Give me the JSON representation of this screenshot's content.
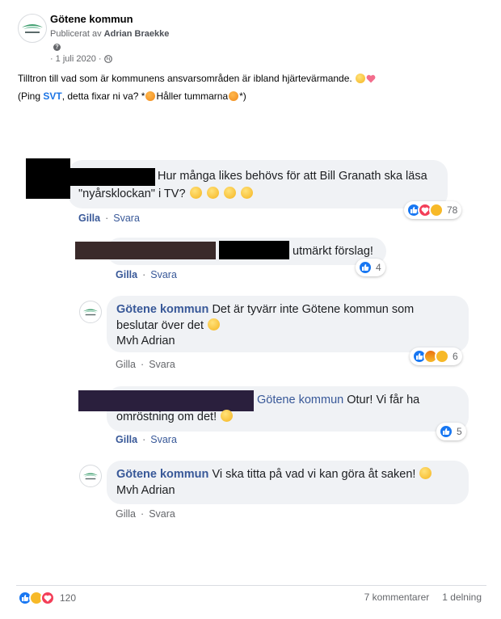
{
  "post": {
    "page_name": "Götene kommun",
    "published_by_prefix": "Publicerat av",
    "published_by_name": "Adrian Braekke",
    "date": "1 juli 2020",
    "text_line1": "Tilltron till vad som är kommunens ansvarsområden är ibland hjärtevärmande.",
    "text_line2_a": "(Ping ",
    "text_line2_link": "SVT",
    "text_line2_b": ", detta fixar ni va? *",
    "text_line2_c": "Håller tummarna",
    "text_line2_d": "*)"
  },
  "comments": [
    {
      "text_a": "Hur många likes behövs för att Bill Granath ska läsa",
      "text_b": "\"nyårsklockan\" i TV?",
      "like": "Gilla",
      "reply": "Svara",
      "reaction_count": "78",
      "reactions": [
        "like-icon",
        "love-icon",
        "haha-icon"
      ]
    },
    {
      "text": "utmärkt förslag!",
      "like": "Gilla",
      "reply": "Svara",
      "reaction_count": "4",
      "reactions": [
        "like-icon"
      ]
    },
    {
      "author": "Götene kommun",
      "text_a": "Det är tyvärr inte Götene kommun som",
      "text_b": "beslutar över det",
      "text_c": "Mvh Adrian",
      "like": "Gilla",
      "reply": "Svara",
      "reaction_count": "6",
      "reactions": [
        "like-icon",
        "angry-icon",
        "sad-icon"
      ]
    },
    {
      "mention": "Götene kommun",
      "text_a": "Otur! Vi får ha",
      "text_b": "omröstning om det!",
      "like": "Gilla",
      "reply": "Svara",
      "reaction_count": "5",
      "reactions": [
        "like-icon"
      ]
    },
    {
      "author": "Götene kommun",
      "text_a": "Vi ska titta på vad vi kan göra åt saken!",
      "text_b": "Mvh Adrian",
      "like": "Gilla",
      "reply": "Svara"
    }
  ],
  "footer": {
    "reaction_count": "120",
    "comments": "7 kommentarer",
    "shares": "1 delning"
  },
  "colors": {
    "link_blue": "#385898",
    "accent_blue": "#1b74e4",
    "bubble_bg": "#f0f2f5",
    "secondary_text": "#65676b"
  }
}
